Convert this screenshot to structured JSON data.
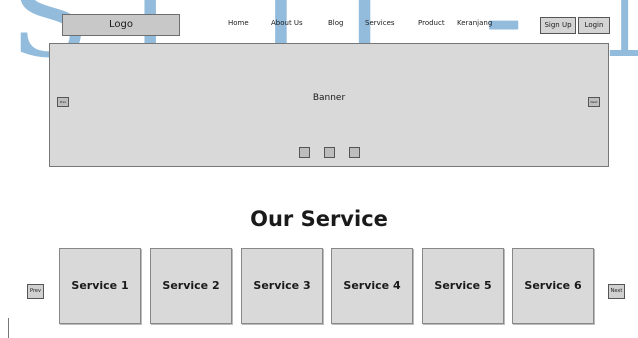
{
  "watermark": {
    "text_left": "ST",
    "text_right": "IT - NE"
  },
  "header": {
    "logo": "Logo",
    "nav": [
      "Home",
      "About Us",
      "Blog",
      "Services",
      "Product",
      "Keranjang"
    ],
    "signup": "Sign Up",
    "login": "Login"
  },
  "banner": {
    "label": "Banner",
    "prev": "Prev",
    "next": "Next",
    "indicator_count": 3
  },
  "services": {
    "title": "Our Service",
    "items": [
      "Service 1",
      "Service 2",
      "Service 3",
      "Service 4",
      "Service 5",
      "Service 6"
    ],
    "prev": "Prev",
    "next": "Next"
  },
  "colors": {
    "watermark": "#7fb0d6",
    "box_fill": "#d9d9d9",
    "border": "#777777"
  }
}
